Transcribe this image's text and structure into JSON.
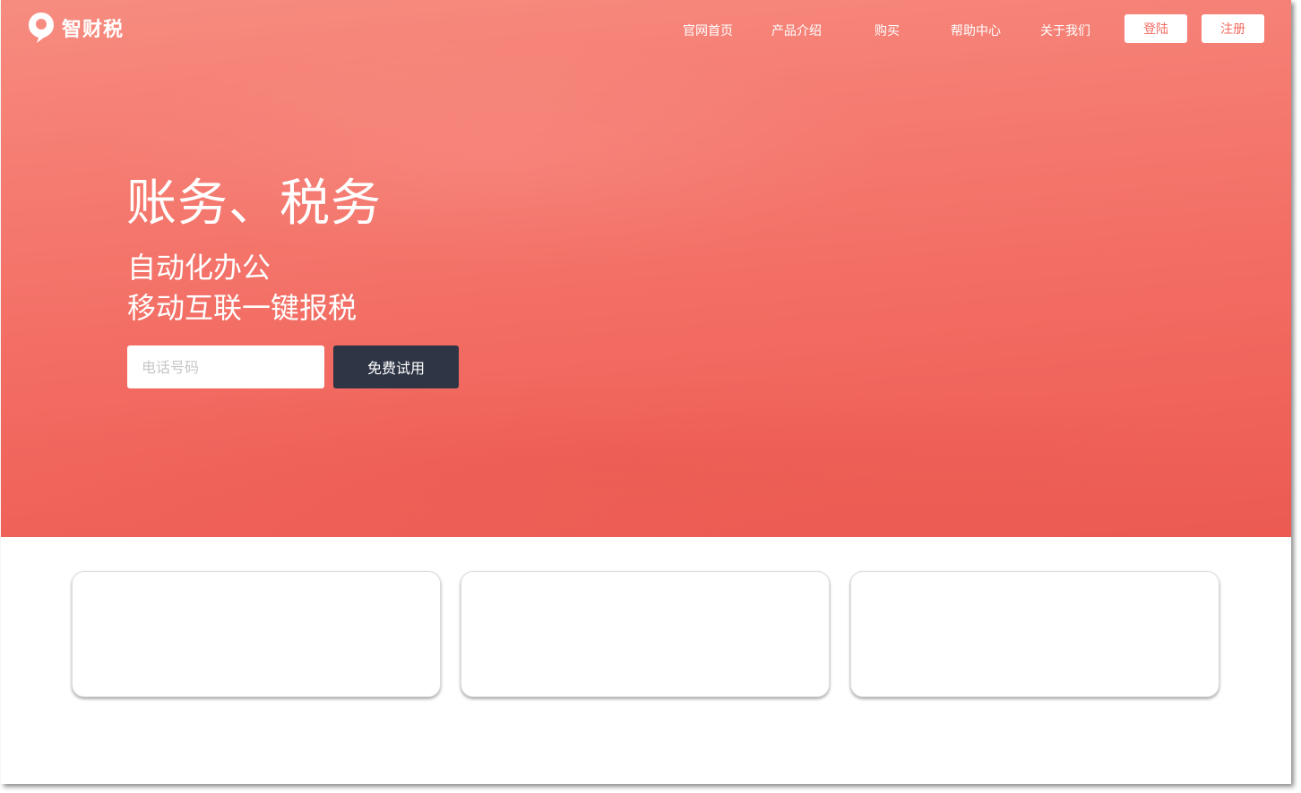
{
  "brand": {
    "name": "智财税",
    "icon": "map-pin-icon"
  },
  "nav": {
    "items": [
      {
        "label": "官网首页"
      },
      {
        "label": "产品介绍"
      },
      {
        "label": "购买"
      },
      {
        "label": "帮助中心"
      },
      {
        "label": "关于我们"
      }
    ],
    "login_label": "登陆",
    "register_label": "注册"
  },
  "hero": {
    "headline": "账务、税务",
    "line1": "自动化办公",
    "line2": "移动互联一键报税",
    "phone_placeholder": "电话号码",
    "phone_value": "",
    "trial_label": "免费试用"
  },
  "colors": {
    "hero_top": "#f68c80",
    "hero_bottom": "#ec5a52",
    "cta_bg": "#2e3545",
    "auth_text": "#f36b62"
  }
}
